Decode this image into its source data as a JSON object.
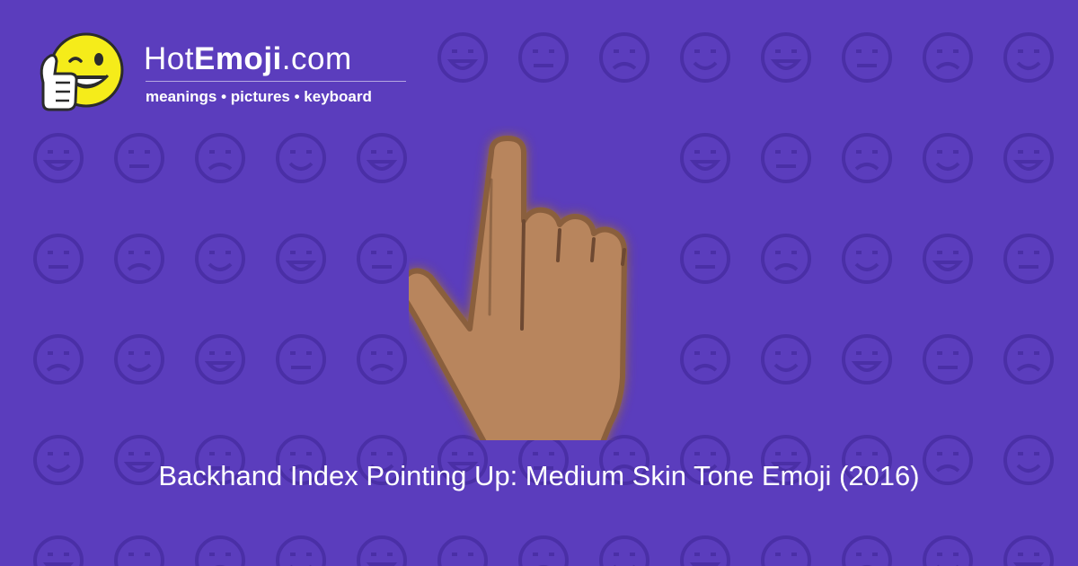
{
  "brand": {
    "name_prefix": "Hot",
    "name_bold": "Emoji",
    "name_suffix": ".com",
    "tagline": "meanings • pictures • keyboard"
  },
  "emoji": {
    "caption": "Backhand Index Pointing Up: Medium Skin Tone Emoji (2016)",
    "icon": "backhand-index-pointing-up-medium-skin-tone"
  },
  "colors": {
    "background": "#5b3dbd",
    "pattern": "#4a2fa6",
    "skin_fill": "#b8855d",
    "skin_outline": "#8a5f3e",
    "mascot_face": "#f5ec1a",
    "text": "#ffffff"
  }
}
